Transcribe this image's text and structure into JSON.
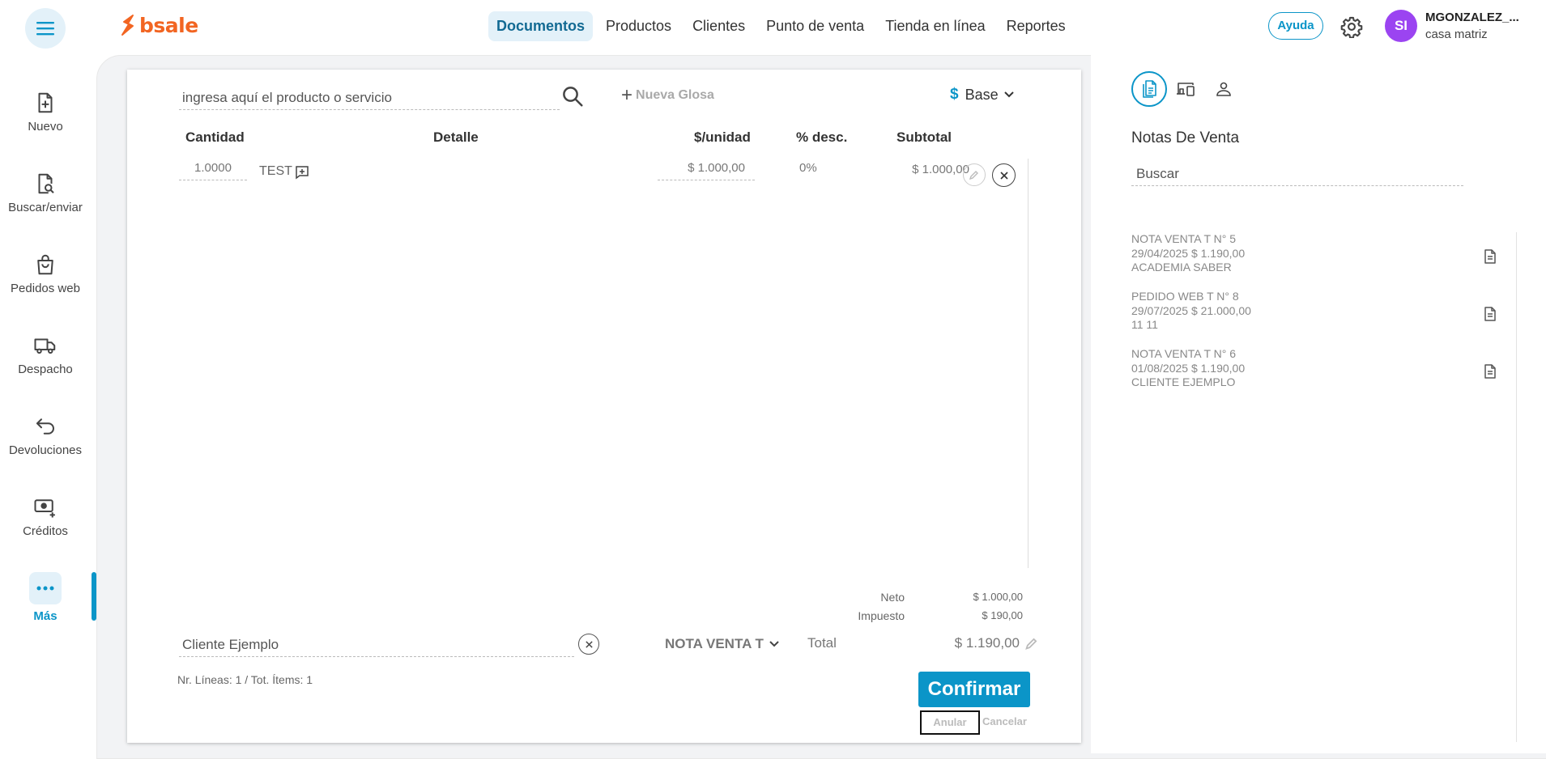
{
  "brand": {
    "name": "bsale",
    "color": "#f26522"
  },
  "accent": "#0b95c8",
  "topnav": {
    "items": [
      {
        "label": "Documentos",
        "active": true
      },
      {
        "label": "Productos"
      },
      {
        "label": "Clientes"
      },
      {
        "label": "Punto de venta"
      },
      {
        "label": "Tienda en línea"
      },
      {
        "label": "Reportes"
      }
    ],
    "help_label": "Ayuda",
    "settings_icon": "gear-icon"
  },
  "user": {
    "initials": "SI",
    "name": "MGONZALEZ_...",
    "branch": "casa matriz",
    "avatar_color": "#9b44f1"
  },
  "sidebar": {
    "items": [
      {
        "label": "Nuevo",
        "icon": "new-document-icon"
      },
      {
        "label": "Buscar/enviar",
        "icon": "search-document-icon"
      },
      {
        "label": "Pedidos web",
        "icon": "shopping-bag-icon"
      },
      {
        "label": "Despacho",
        "icon": "truck-icon"
      },
      {
        "label": "Devoluciones",
        "icon": "return-arrow-icon"
      },
      {
        "label": "Créditos",
        "icon": "money-plus-icon"
      },
      {
        "label": "Más",
        "icon": "more-dots-icon",
        "active": true
      }
    ]
  },
  "document": {
    "search_placeholder": "ingresa aquí el producto o servicio",
    "nueva_glosa_label": "Nueva Glosa",
    "currency_symbol": "$",
    "price_list_label": "Base",
    "columns": {
      "quantity": "Cantidad",
      "detail": "Detalle",
      "unit_price": "$/unidad",
      "discount": "% desc.",
      "subtotal": "Subtotal"
    },
    "lines": [
      {
        "quantity": "1.0000",
        "detail": "TEST",
        "unit_price": "$ 1.000,00",
        "discount": "0%",
        "subtotal": "$ 1.000,00"
      }
    ],
    "summary": {
      "neto_label": "Neto",
      "neto_value": "$ 1.000,00",
      "impuesto_label": "Impuesto",
      "impuesto_value": "$ 190,00",
      "total_label": "Total",
      "total_value": "$ 1.190,00"
    },
    "client_value": "Cliente Ejemplo",
    "doc_type": "NOTA VENTA T",
    "lines_info": "Nr. Líneas: 1 / Tot. Ítems: 1",
    "confirm_label": "Confirmar",
    "anular_label": "Anular",
    "cancelar_label": "Cancelar"
  },
  "right_panel": {
    "tabs": [
      {
        "icon": "document-list-icon",
        "active": true
      },
      {
        "icon": "devices-icon"
      },
      {
        "icon": "person-icon"
      }
    ],
    "title": "Notas De Venta",
    "search_placeholder": "Buscar",
    "notes": [
      {
        "line1": "NOTA VENTA T N° 5",
        "line2": "29/04/2025 $ 1.190,00",
        "line3": "ACADEMIA SABER"
      },
      {
        "line1": "PEDIDO WEB T N° 8",
        "line2": "29/07/2025 $ 21.000,00",
        "line3": "11 11"
      },
      {
        "line1": "NOTA VENTA T N° 6",
        "line2": "01/08/2025 $ 1.190,00",
        "line3": "CLIENTE EJEMPLO"
      }
    ]
  }
}
